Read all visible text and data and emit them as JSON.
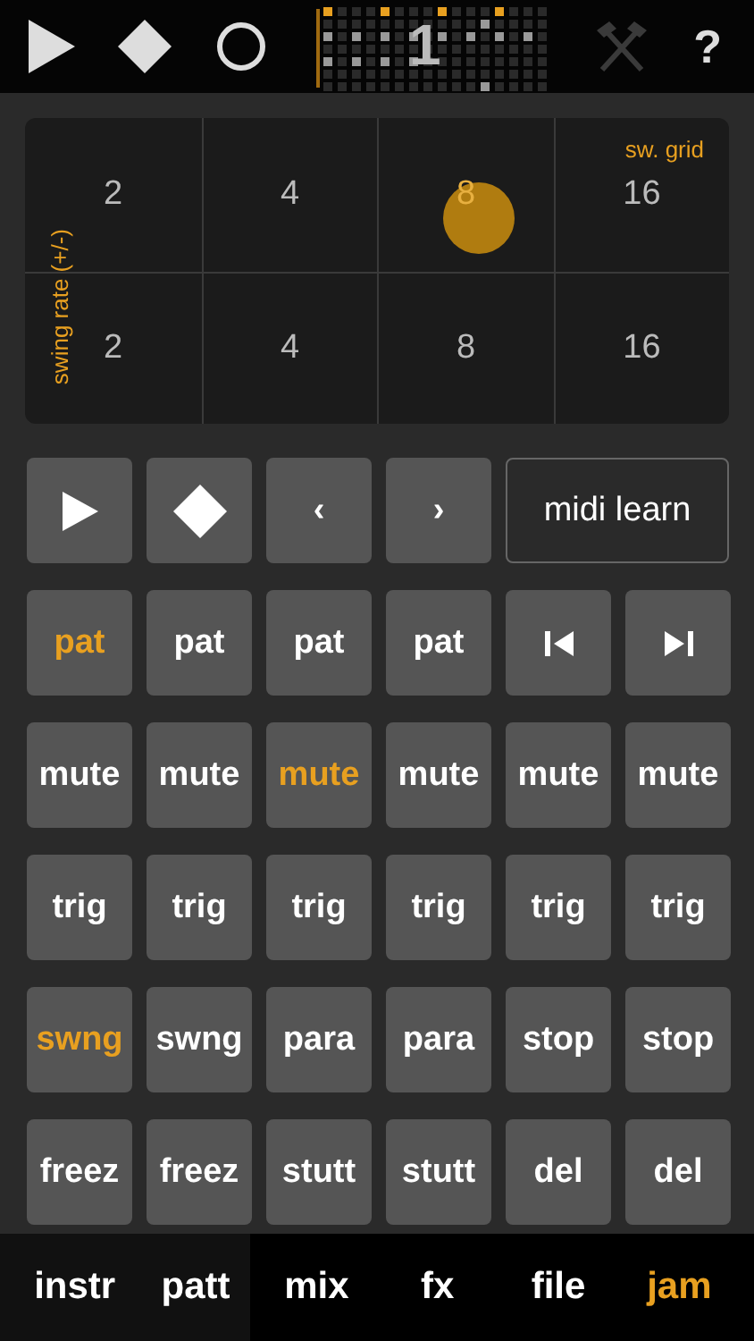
{
  "toolbar": {
    "pattern_number": "1",
    "help": "?"
  },
  "swing_pad": {
    "x_label": "sw. grid",
    "y_label": "swing rate (+/-)",
    "rows": [
      {
        "cells": [
          {
            "label": "2",
            "selected": false
          },
          {
            "label": "4",
            "selected": false
          },
          {
            "label": "8",
            "selected": true
          },
          {
            "label": "16",
            "selected": false
          }
        ]
      },
      {
        "cells": [
          {
            "label": "2",
            "selected": false
          },
          {
            "label": "4",
            "selected": false
          },
          {
            "label": "8",
            "selected": false
          },
          {
            "label": "16",
            "selected": false
          }
        ]
      }
    ]
  },
  "transport": [
    {
      "kind": "play"
    },
    {
      "kind": "stop"
    },
    {
      "kind": "text",
      "label": "‹"
    },
    {
      "kind": "text",
      "label": "›"
    },
    {
      "kind": "wide",
      "label": "midi learn"
    }
  ],
  "pads": [
    [
      {
        "kind": "text",
        "label": "pat",
        "active": true
      },
      {
        "kind": "text",
        "label": "pat",
        "active": false
      },
      {
        "kind": "text",
        "label": "pat",
        "active": false
      },
      {
        "kind": "text",
        "label": "pat",
        "active": false
      },
      {
        "kind": "prev",
        "active": false
      },
      {
        "kind": "next",
        "active": false
      }
    ],
    [
      {
        "kind": "text",
        "label": "mute",
        "active": false
      },
      {
        "kind": "text",
        "label": "mute",
        "active": false
      },
      {
        "kind": "text",
        "label": "mute",
        "active": true
      },
      {
        "kind": "text",
        "label": "mute",
        "active": false
      },
      {
        "kind": "text",
        "label": "mute",
        "active": false
      },
      {
        "kind": "text",
        "label": "mute",
        "active": false
      }
    ],
    [
      {
        "kind": "text",
        "label": "trig",
        "active": false
      },
      {
        "kind": "text",
        "label": "trig",
        "active": false
      },
      {
        "kind": "text",
        "label": "trig",
        "active": false
      },
      {
        "kind": "text",
        "label": "trig",
        "active": false
      },
      {
        "kind": "text",
        "label": "trig",
        "active": false
      },
      {
        "kind": "text",
        "label": "trig",
        "active": false
      }
    ],
    [
      {
        "kind": "text",
        "label": "swng",
        "active": true
      },
      {
        "kind": "text",
        "label": "swng",
        "active": false
      },
      {
        "kind": "text",
        "label": "para",
        "active": false
      },
      {
        "kind": "text",
        "label": "para",
        "active": false
      },
      {
        "kind": "text",
        "label": "stop",
        "active": false
      },
      {
        "kind": "text",
        "label": "stop",
        "active": false
      }
    ],
    [
      {
        "kind": "text",
        "label": "freez",
        "active": false
      },
      {
        "kind": "text",
        "label": "freez",
        "active": false
      },
      {
        "kind": "text",
        "label": "stutt",
        "active": false
      },
      {
        "kind": "text",
        "label": "stutt",
        "active": false
      },
      {
        "kind": "text",
        "label": "del",
        "active": false
      },
      {
        "kind": "text",
        "label": "del",
        "active": false
      }
    ]
  ],
  "tabs": [
    {
      "label": "instr",
      "selected": false
    },
    {
      "label": "patt",
      "selected": false
    },
    {
      "label": "mix",
      "selected": false
    },
    {
      "label": "fx",
      "selected": false
    },
    {
      "label": "file",
      "selected": false
    },
    {
      "label": "jam",
      "selected": true
    }
  ]
}
